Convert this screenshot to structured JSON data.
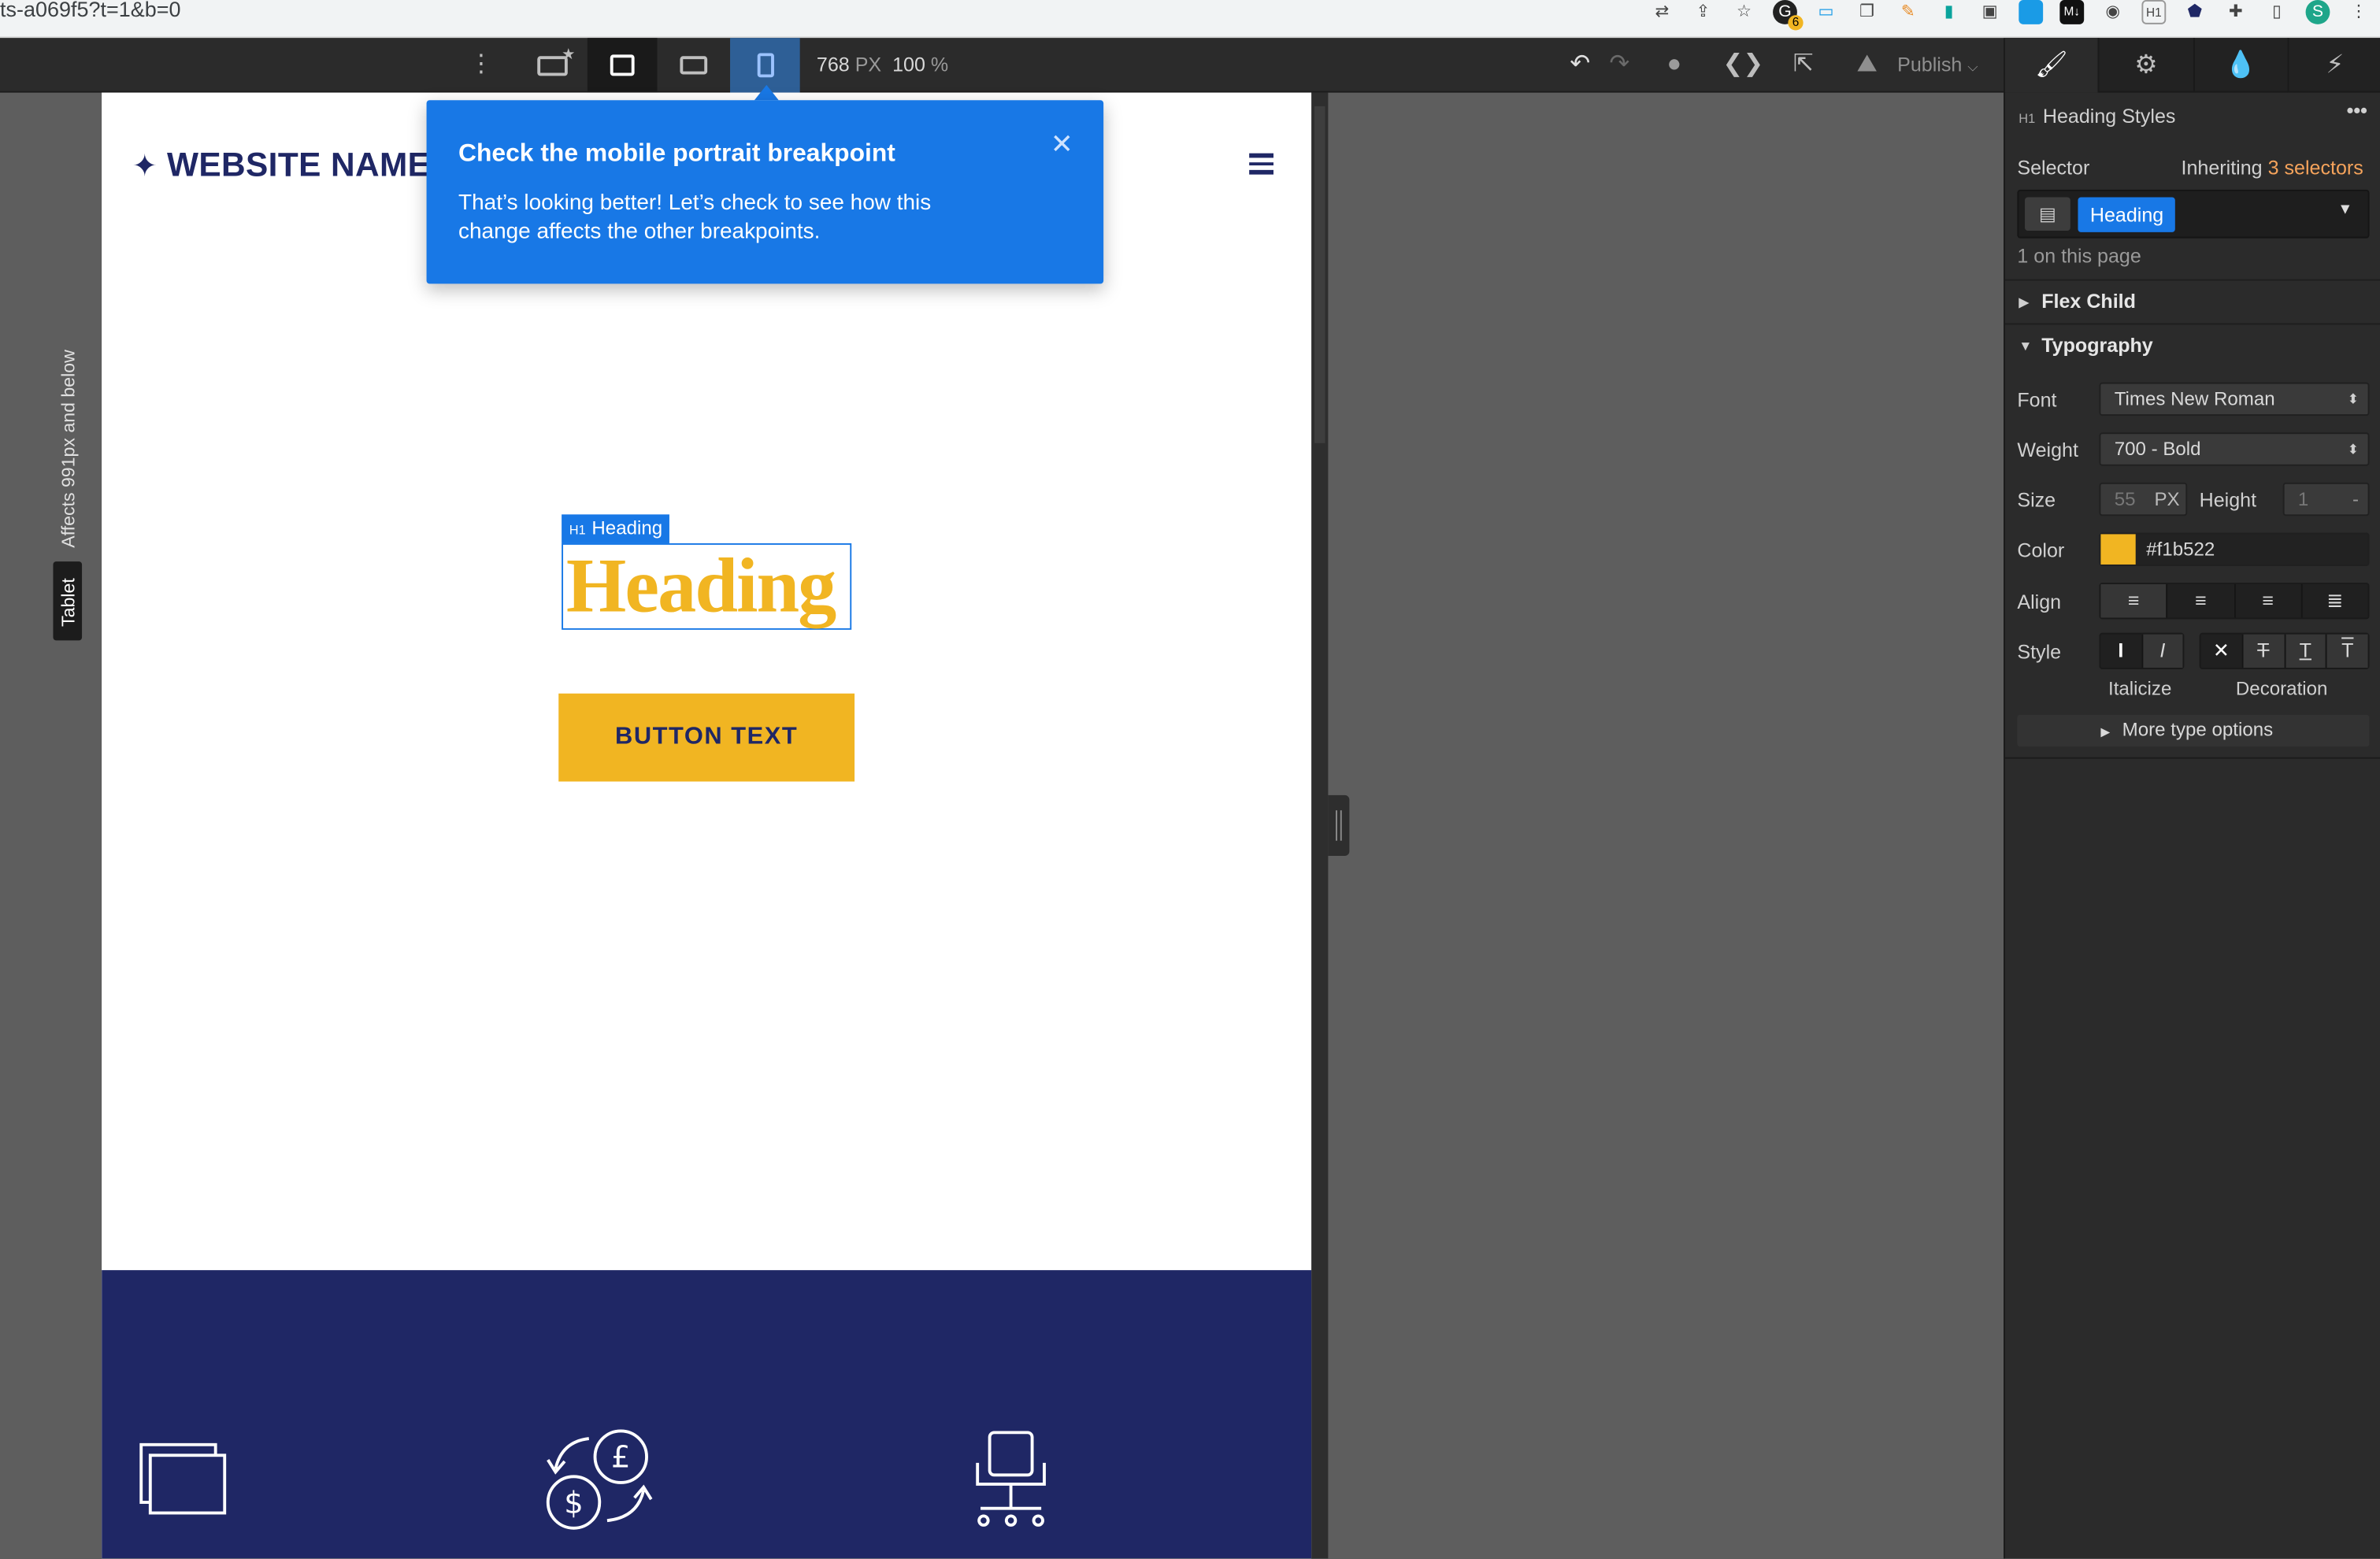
{
  "browser": {
    "url_fragment": "ts-a069f5?t=1&b=0",
    "extension_badge": "6"
  },
  "topbar": {
    "width_value": "768",
    "width_unit": "PX",
    "zoom_value": "100",
    "zoom_unit": "%",
    "publish_label": "Publish"
  },
  "tooltip": {
    "title": "Check the mobile portrait breakpoint",
    "body": "That’s looking better! Let’s check to see how this change affects the other breakpoints."
  },
  "canvas": {
    "logo_text": "WEBSITE NAME",
    "logo_star": "✦",
    "element_tag_prefix": "H1",
    "element_tag_label": "Heading",
    "heading_text": "Heading",
    "button_text": "BUTTON TEXT"
  },
  "side_labels": {
    "breakpoint_name": "Tablet",
    "affects_text": "Affects 991px and below"
  },
  "panel": {
    "element_prefix": "H1",
    "element_title": "Heading Styles",
    "selector_label": "Selector",
    "inheriting_text": "Inheriting",
    "inheriting_count": "3 selectors",
    "selector_token": "Heading",
    "on_page_text": "1 on this page",
    "section_flex_child": "Flex Child",
    "section_typography": "Typography",
    "font_label": "Font",
    "font_value": "Times New Roman",
    "weight_label": "Weight",
    "weight_value": "700 - Bold",
    "size_label": "Size",
    "size_value": "55",
    "size_unit": "PX",
    "height_label": "Height",
    "height_value": "1",
    "height_unit": "-",
    "color_label": "Color",
    "color_value": "#f1b522",
    "align_label": "Align",
    "style_label": "Style",
    "italicize_label": "Italicize",
    "decoration_label": "Decoration",
    "more_options_label": "More type options"
  },
  "colors": {
    "brand_navy": "#1f2765",
    "accent_yellow": "#f1b522",
    "selection_blue": "#1878e6",
    "inherit_orange": "#f5a35b"
  },
  "icons": [
    "more-vertical-icon",
    "desktop-star-icon",
    "desktop-icon",
    "tablet-landscape-icon",
    "tablet-portrait-icon",
    "undo-icon",
    "redo-icon",
    "comments-icon",
    "code-icon",
    "export-icon",
    "publish-icon",
    "brush-icon",
    "gear-icon",
    "drops-icon",
    "bolt-icon",
    "hamburger-icon",
    "close-icon",
    "screens-icon",
    "currency-exchange-icon",
    "office-chair-icon"
  ]
}
